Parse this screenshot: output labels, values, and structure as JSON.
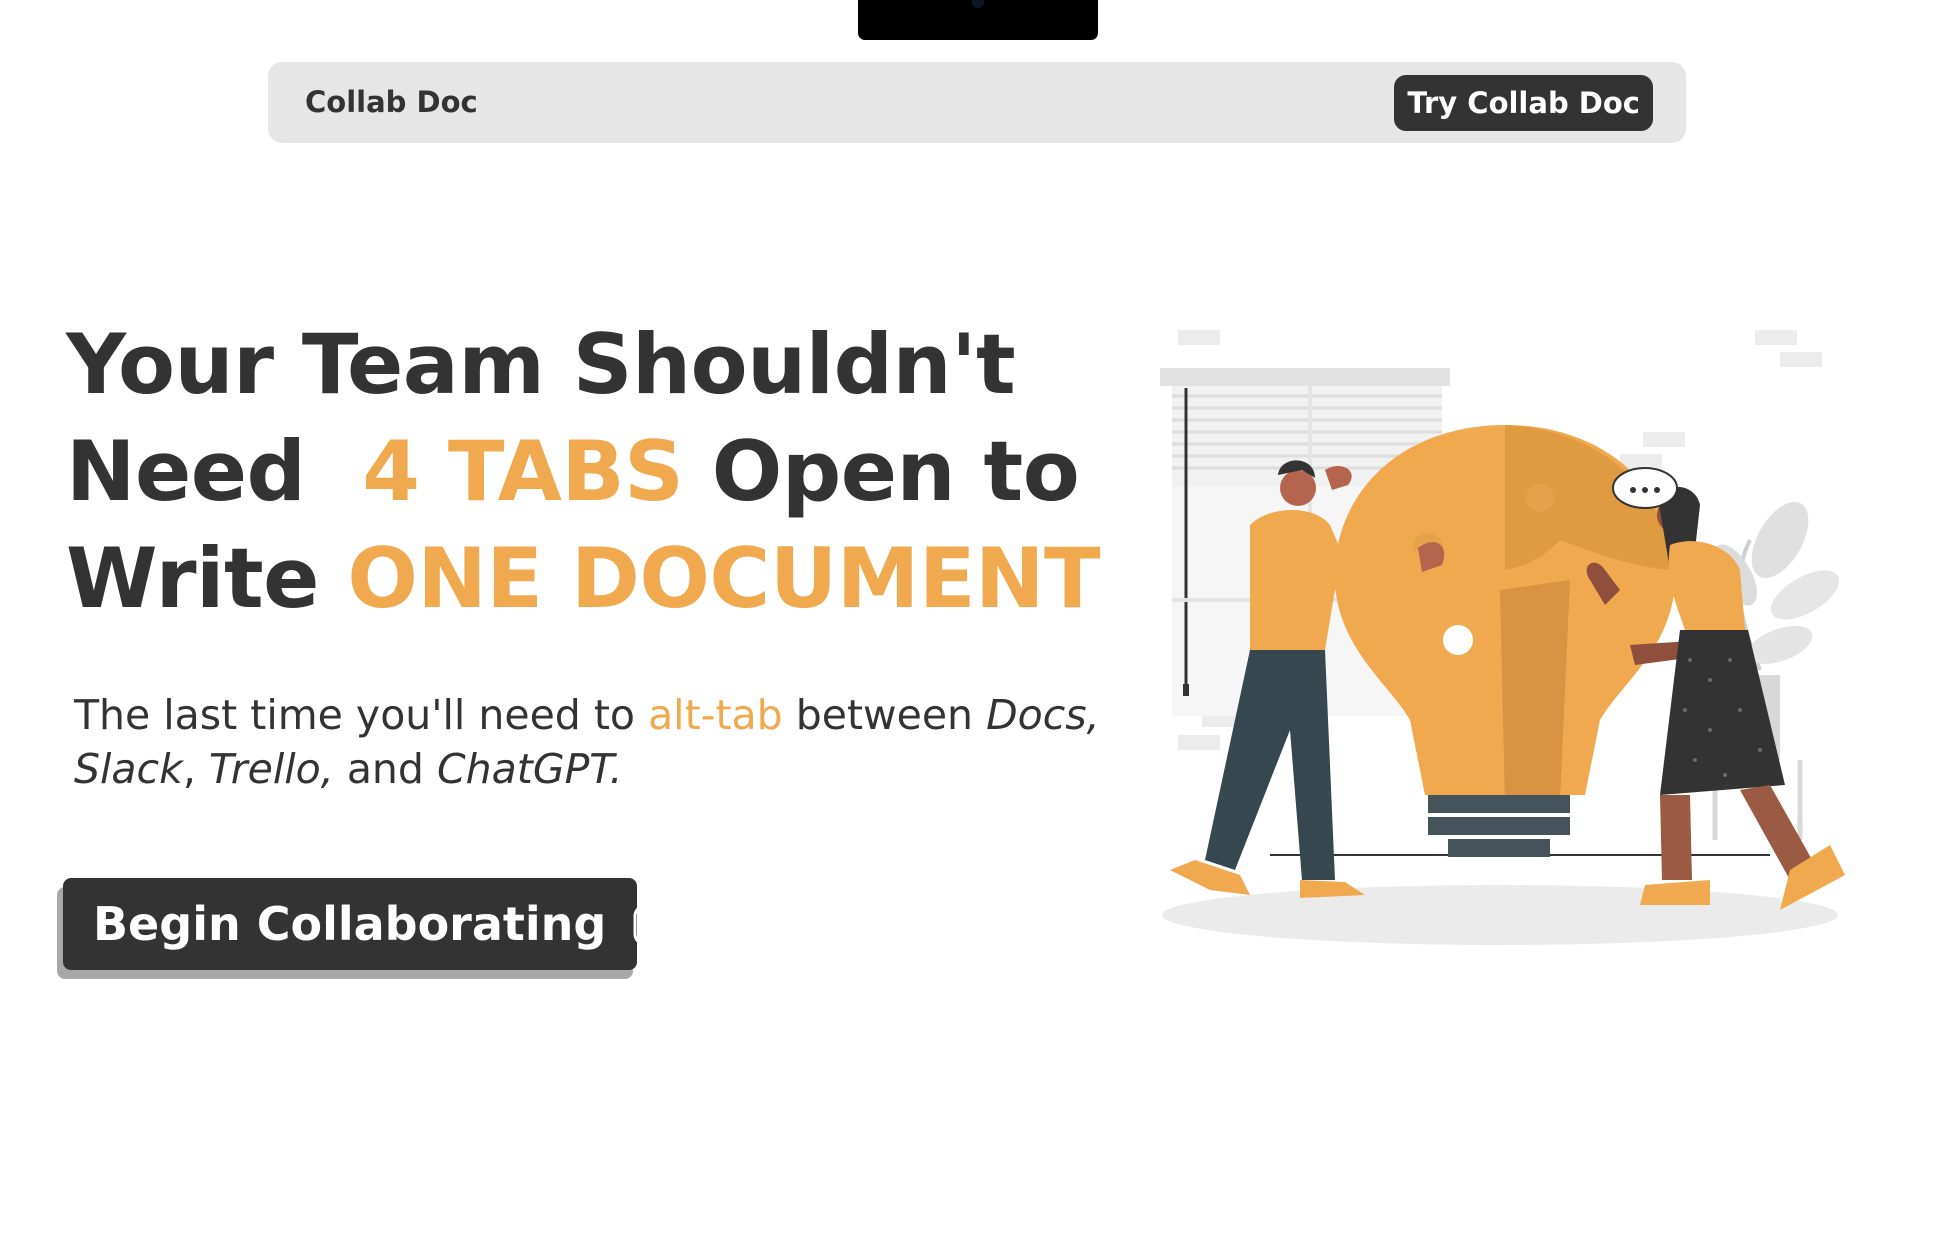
{
  "navbar": {
    "brand": "Collab Doc",
    "cta_label": "Try Collab Doc"
  },
  "hero": {
    "headline": {
      "line1": "Your Team Shouldn't",
      "line2_start": "Need",
      "line2_accent": "4 TABS",
      "line2_end": "Open to",
      "line3_start": "Write",
      "line3_accent": "ONE DOCUMENT"
    },
    "subtext": {
      "part1": "The last time you'll need to",
      "highlight": "alt-tab",
      "part2": "between",
      "app1": "Docs,",
      "app2": "Slack",
      "sep1": ",",
      "app3": "Trello,",
      "part3": "and",
      "app4": "ChatGPT."
    },
    "cta_label": "Begin Collaborating"
  },
  "icons": {
    "cta_icon": "chevron-right-square-icon",
    "illustration": "teamwork-lightbulb-puzzle-illustration"
  },
  "colors": {
    "accent": "#f0a94e",
    "dark": "#333333",
    "navbar_bg": "#e6e6e6"
  }
}
